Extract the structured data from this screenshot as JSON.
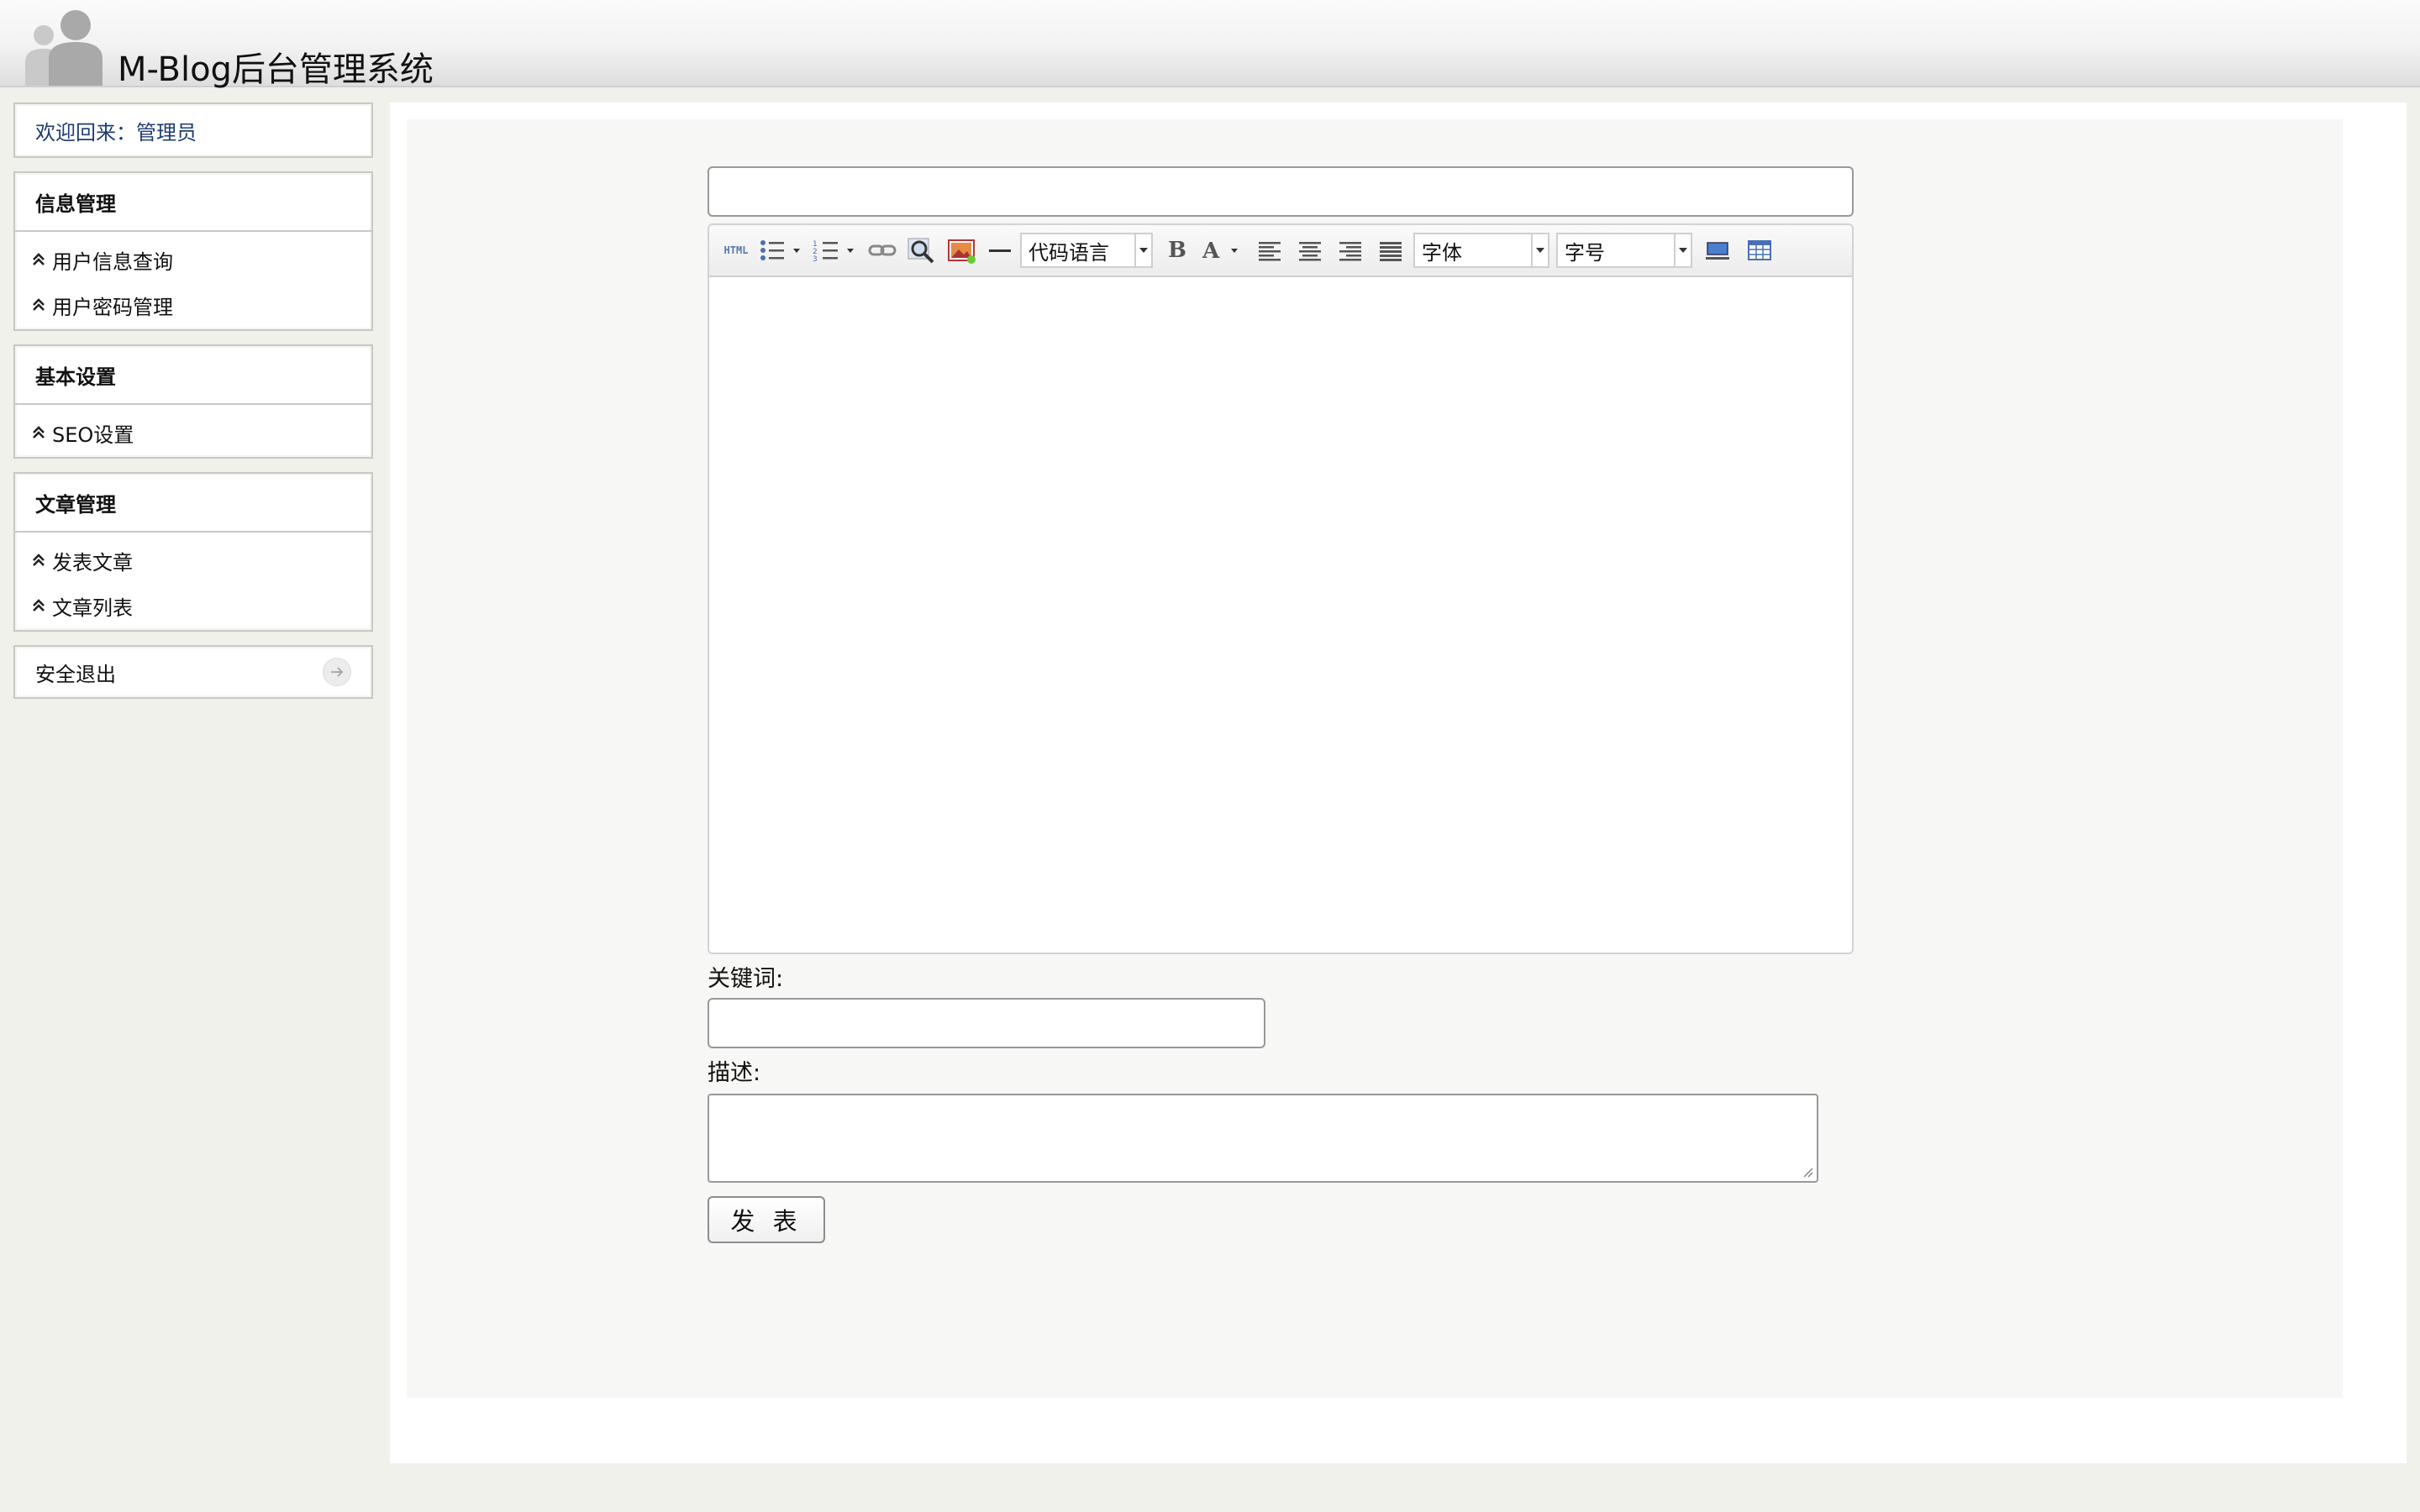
{
  "header": {
    "title": "M-Blog后台管理系统"
  },
  "sidebar": {
    "welcome": "欢迎回来：管理员",
    "groups": [
      {
        "title": "信息管理",
        "items": [
          "用户信息查询",
          "用户密码管理"
        ]
      },
      {
        "title": "基本设置",
        "items": [
          "SEO设置"
        ]
      },
      {
        "title": "文章管理",
        "items": [
          "发表文章",
          "文章列表"
        ]
      }
    ],
    "logout": "安全退出"
  },
  "editor": {
    "title_value": "",
    "toolbar": {
      "html_label": "HTML",
      "code_language": "代码语言",
      "font_family": "字体",
      "font_size": "字号"
    }
  },
  "form": {
    "keywords_label": "关键词:",
    "keywords_value": "",
    "description_label": "描述:",
    "description_value": "",
    "submit_label": "发 表"
  },
  "colors": {
    "page_bg": "#f1f1eb",
    "welcome_text": "#1f3c74",
    "content_bg": "#f7f7f6"
  }
}
